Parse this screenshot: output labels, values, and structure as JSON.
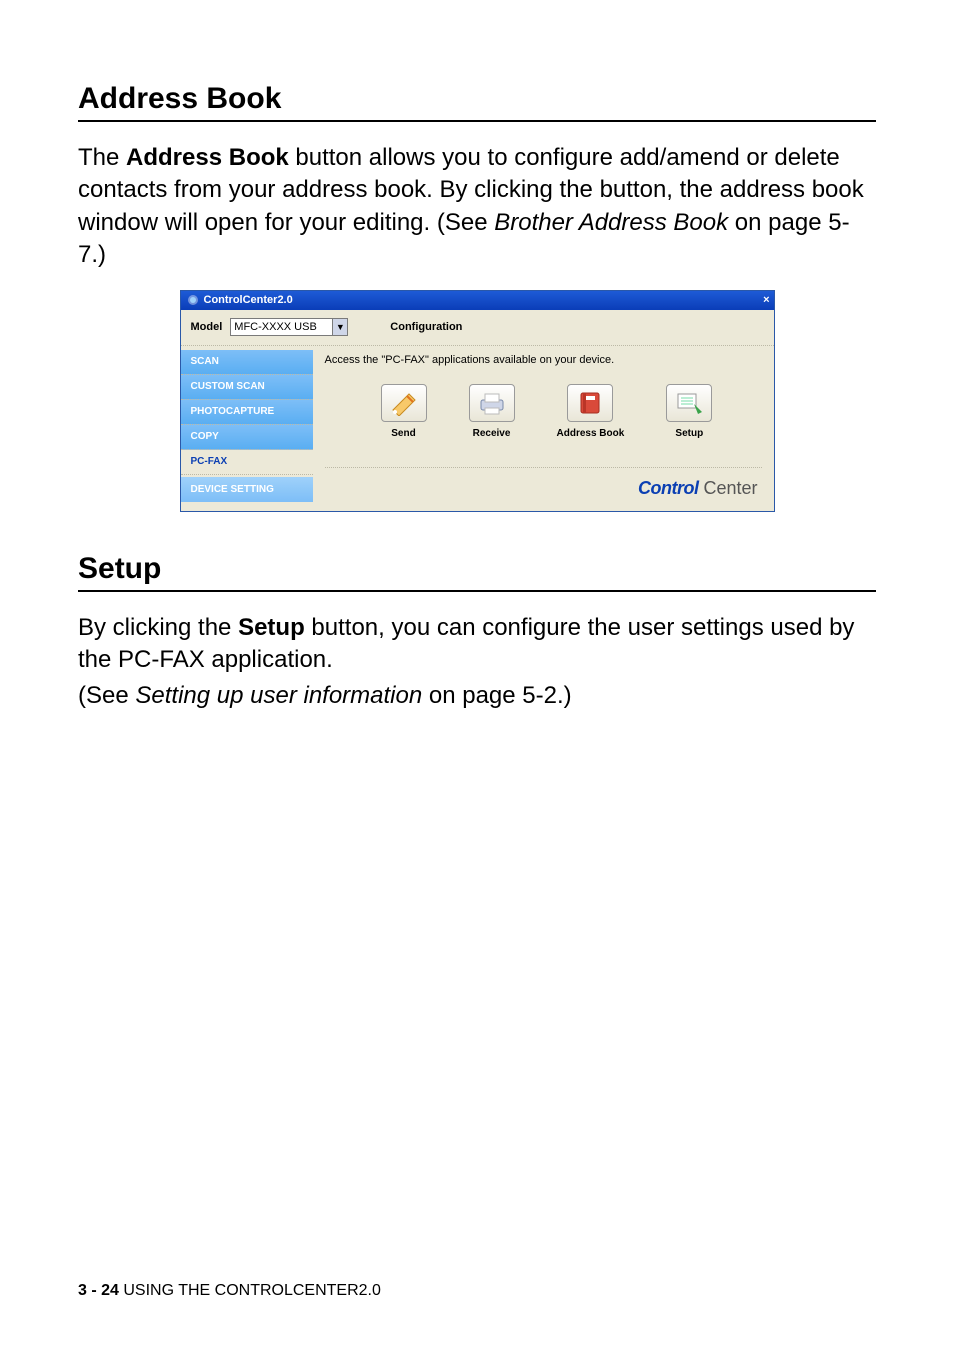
{
  "section1": {
    "title": "Address Book",
    "para_part1": "The ",
    "para_bold": "Address Book",
    "para_part2": " button allows you to configure add/amend or delete contacts from your address book. By clicking the button, the address book window will open for your editing. (See ",
    "para_italic": "Brother Address Book",
    "para_part3": " on page 5-7.)"
  },
  "screenshot": {
    "window_title": "ControlCenter2.0",
    "model_label": "Model",
    "model_value": "MFC-XXXX USB",
    "configuration": "Configuration",
    "sidebar": {
      "scan": "SCAN",
      "custom_scan": "CUSTOM SCAN",
      "photocapture": "PHOTOCAPTURE",
      "copy": "COPY",
      "pcfax": "PC-FAX",
      "device_setting": "DEVICE SETTING"
    },
    "description": "Access the \"PC-FAX\" applications available on your device.",
    "buttons": {
      "send": "Send",
      "receive": "Receive",
      "address_book": "Address Book",
      "setup": "Setup"
    },
    "logo_control": "Control",
    "logo_center": " Center"
  },
  "section2": {
    "title": "Setup",
    "para_part1": "By clicking the ",
    "para_bold": "Setup",
    "para_part2": " button, you can configure the user settings used by the PC-FAX application.",
    "para2_part1": "(See ",
    "para2_italic": "Setting up user information",
    "para2_part2": " on page 5-2.)"
  },
  "footer": {
    "page": "3 - 24",
    "sep": "   ",
    "text": "USING THE CONTROLCENTER2.0"
  }
}
